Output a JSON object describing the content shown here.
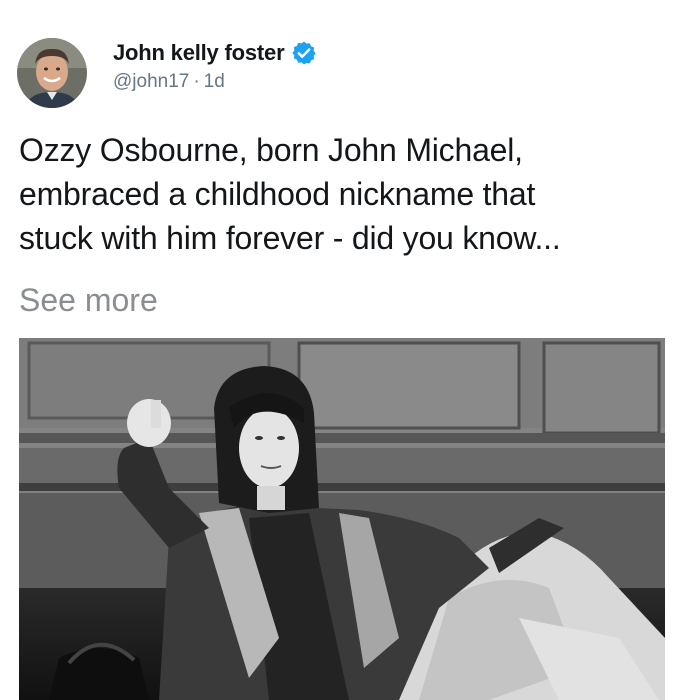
{
  "tweet": {
    "author": {
      "display_name": "John kelly foster",
      "handle": "@john17",
      "verified": true,
      "avatar_icon": "profile-photo"
    },
    "separator": "·",
    "timestamp": "1d",
    "text_lines": [
      "Ozzy Osbourne, born John Michael,",
      "embraced a childhood nickname that",
      "stuck with him forever - did you know..."
    ],
    "see_more": "See more",
    "media": {
      "type": "black-and-white photo"
    }
  },
  "colors": {
    "primary_text": "#14171a",
    "secondary_text": "#657786",
    "see_more": "#8a8d91",
    "verified_badge": "#1da1f2",
    "background": "#ffffff"
  }
}
